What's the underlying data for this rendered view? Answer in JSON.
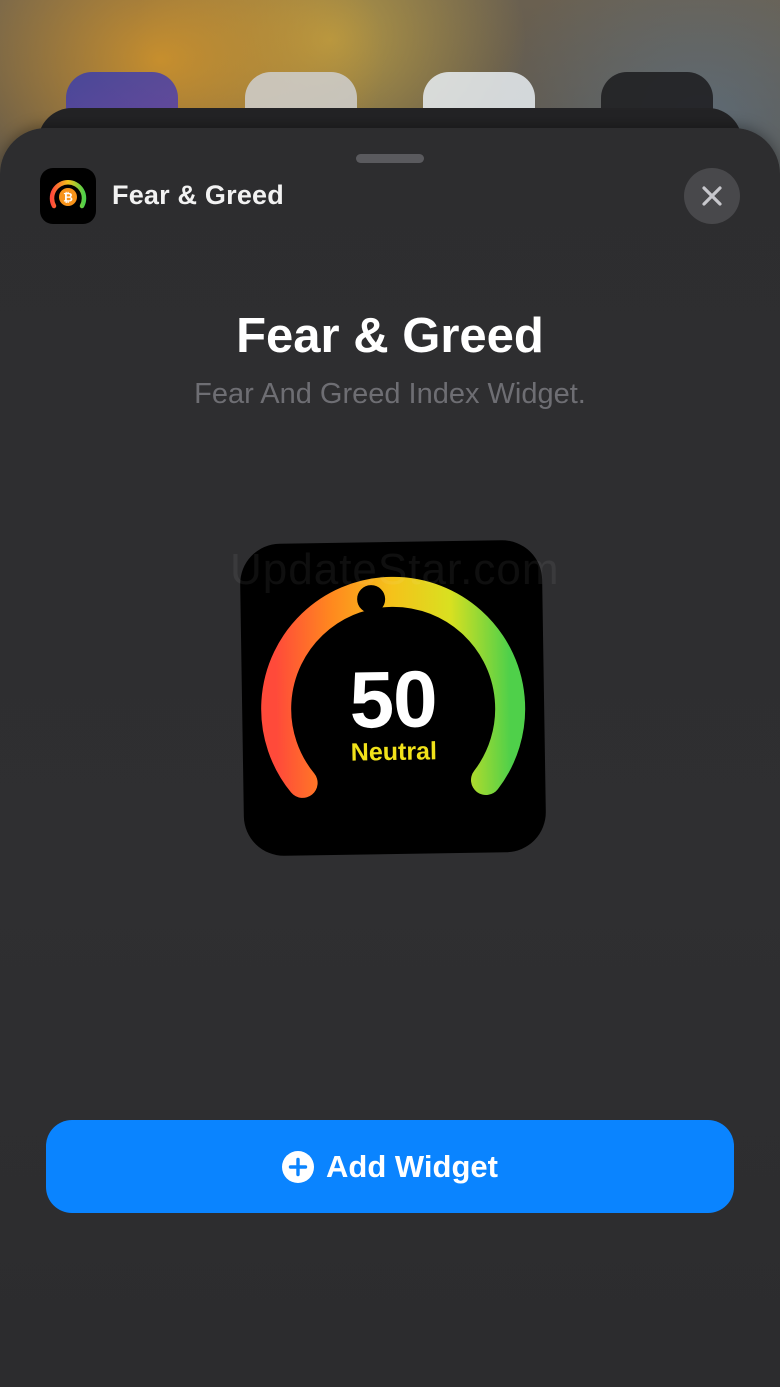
{
  "header": {
    "app_name": "Fear & Greed",
    "app_icon": "bitcoin-gauge-icon",
    "close_icon": "close-icon"
  },
  "main": {
    "title": "Fear & Greed",
    "subtitle": "Fear And Greed Index Widget."
  },
  "widget": {
    "value": "50",
    "label": "Neutral",
    "progress": 0.5,
    "label_color": "#f1e21a",
    "gradient_colors": [
      "#ff4a3a",
      "#ff8a1e",
      "#f5c21a",
      "#d9e020",
      "#4fd04a"
    ],
    "watermark": "UpdateStar.com"
  },
  "footer": {
    "add_button_label": "Add Widget",
    "add_icon": "plus-circle-icon"
  },
  "colors": {
    "accent": "#0a84ff",
    "sheet_bg": "#2d2d2f"
  }
}
